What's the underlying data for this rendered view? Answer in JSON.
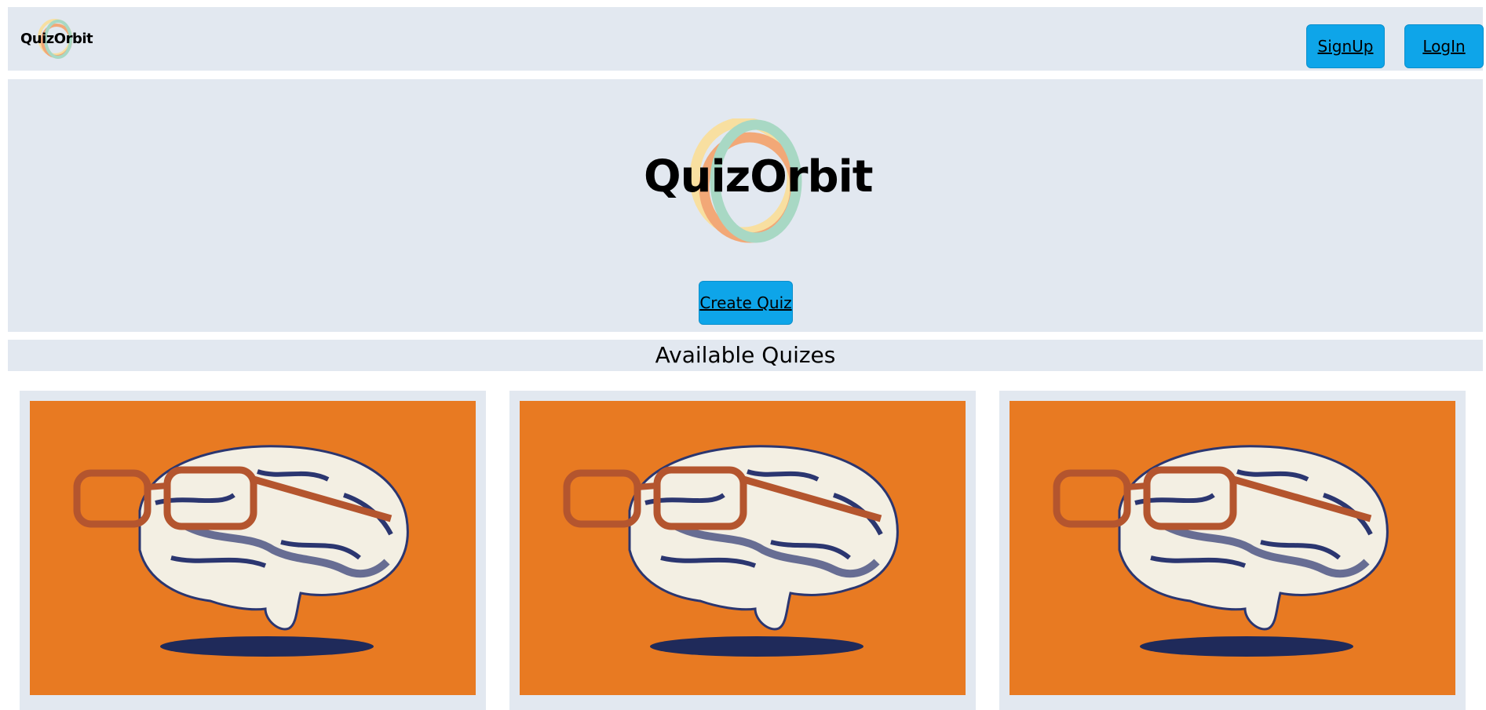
{
  "navbar": {
    "logo_text": "QuizOrbit",
    "signup_label": "SignUp",
    "login_label": "LogIn"
  },
  "hero": {
    "logo_text": "QuizOrbit",
    "create_quiz_label": "Create Quiz"
  },
  "quizzes": {
    "heading": "Available Quizes",
    "cards": [
      {
        "image": "brain-with-glasses-illustration"
      },
      {
        "image": "brain-with-glasses-illustration"
      },
      {
        "image": "brain-with-glasses-illustration"
      }
    ]
  },
  "colors": {
    "panel": "#e2e8f0",
    "button": "#0ea5e9",
    "card_image_bg": "#e87a22",
    "logo_yellow": "#f8dfa0",
    "logo_orange": "#f2a877",
    "logo_green": "#a8d8c4"
  }
}
